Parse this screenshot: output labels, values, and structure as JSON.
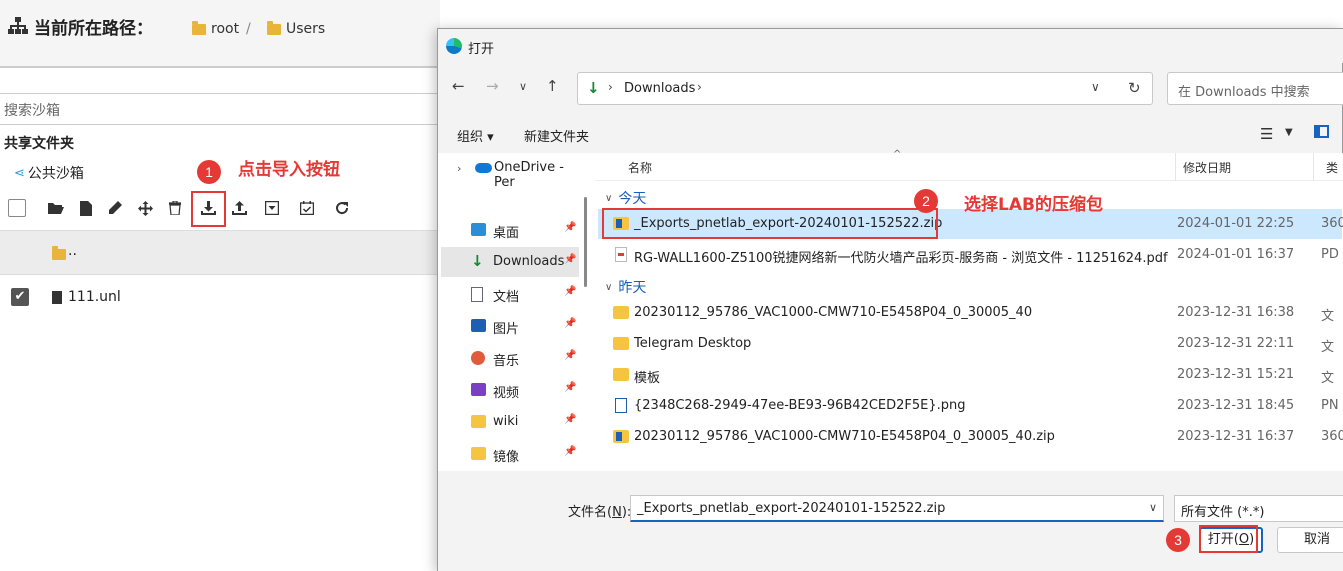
{
  "web": {
    "path_title": "当前所在路径：",
    "crumb_root": "root",
    "crumb_sep": "/",
    "crumb_users": "Users",
    "search_placeholder": "搜索沙箱",
    "shared_folders": "共享文件夹",
    "public_sandbox": "公共沙箱",
    "parent_dir": "..",
    "file_name": "111.unl",
    "step1_badge": "1",
    "step1_text": "点击导入按钮"
  },
  "dialog": {
    "title": "打开",
    "address": "Downloads",
    "search_placeholder": "在 Downloads 中搜索",
    "organize": "组织 ▾",
    "new_folder": "新建文件夹",
    "columns": {
      "name": "名称",
      "date": "修改日期",
      "type": "类"
    },
    "nav": [
      {
        "label": "OneDrive - Per"
      },
      {
        "label": "桌面"
      },
      {
        "label": "Downloads"
      },
      {
        "label": "文档"
      },
      {
        "label": "图片"
      },
      {
        "label": "音乐"
      },
      {
        "label": "视频"
      },
      {
        "label": "wiki"
      },
      {
        "label": "镜像"
      }
    ],
    "groups": {
      "today": "今天",
      "yesterday": "昨天"
    },
    "files": [
      {
        "name": "_Exports_pnetlab_export-20240101-152522.zip",
        "date": "2024-01-01 22:25",
        "type": "360",
        "icon": "zip"
      },
      {
        "name": "RG-WALL1600-Z5100锐捷网络新一代防火墙产品彩页-服务商 - 浏览文件 - 11251624.pdf",
        "date": "2024-01-01 16:37",
        "type": "PD",
        "icon": "pdf"
      },
      {
        "name": "20230112_95786_VAC1000-CMW710-E5458P04_0_30005_40",
        "date": "2023-12-31 16:38",
        "type": "文",
        "icon": "folder"
      },
      {
        "name": "Telegram Desktop",
        "date": "2023-12-31 22:11",
        "type": "文",
        "icon": "folder"
      },
      {
        "name": "模板",
        "date": "2023-12-31 15:21",
        "type": "文",
        "icon": "folder"
      },
      {
        "name": "{2348C268-2949-47ee-BE93-96B42CED2F5E}.png",
        "date": "2023-12-31 18:45",
        "type": "PN",
        "icon": "png"
      },
      {
        "name": "20230112_95786_VAC1000-CMW710-E5458P04_0_30005_40.zip",
        "date": "2023-12-31 16:37",
        "type": "360",
        "icon": "zip"
      }
    ],
    "filename_label_pre": "文件名(",
    "filename_label_key": "N",
    "filename_label_post": "):",
    "filename_value": "_Exports_pnetlab_export-20240101-152522.zip",
    "filter": "所有文件 (*.*)",
    "open_pre": "打开(",
    "open_key": "O",
    "open_post": ")",
    "cancel": "取消",
    "step2_badge": "2",
    "step2_text": "选择LAB的压缩包",
    "step3_badge": "3"
  }
}
